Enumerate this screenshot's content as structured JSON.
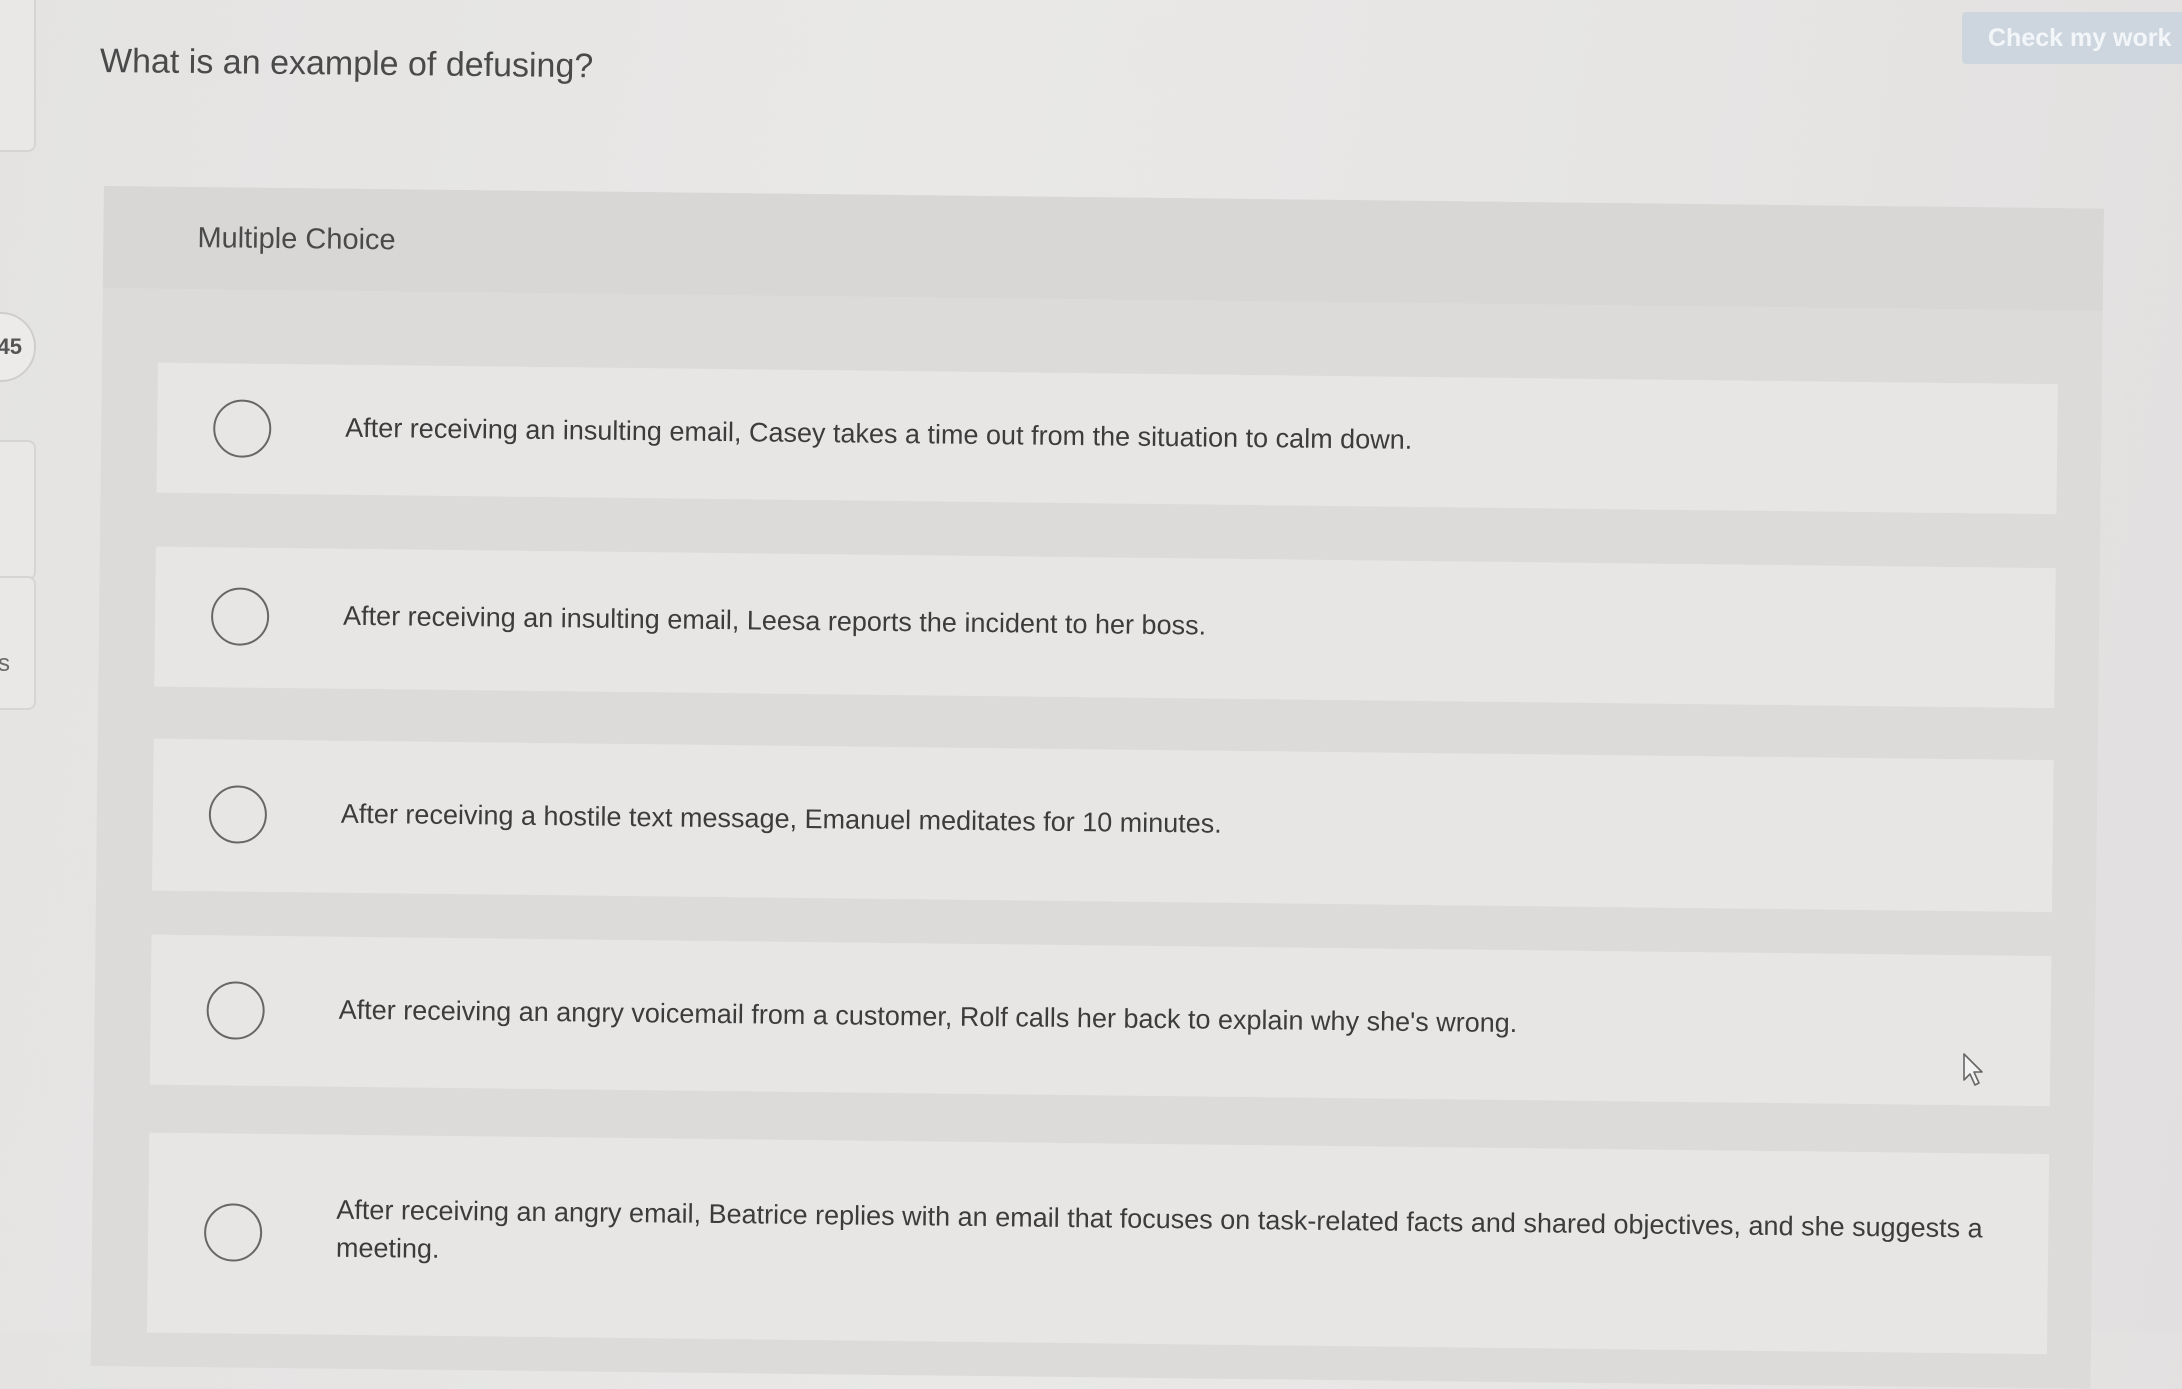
{
  "left_rail": {
    "badge_number": "45",
    "partial_label": "s"
  },
  "question": {
    "prompt": "What is an example of defusing?"
  },
  "header": {
    "check_button_label": "Check my work"
  },
  "panel": {
    "type_label": "Multiple Choice"
  },
  "options": [
    {
      "label": "After receiving an insulting email, Casey takes a time out from the situation to calm down."
    },
    {
      "label": "After receiving an insulting email, Leesa reports the incident to her boss."
    },
    {
      "label": "After receiving a hostile text message, Emanuel meditates for 10 minutes."
    },
    {
      "label": "After receiving an angry voicemail from a customer, Rolf calls her back to explain why she's wrong."
    },
    {
      "label": "After receiving an angry email, Beatrice replies with an email that focuses on task-related facts and shared objectives, and she suggests a meeting."
    }
  ],
  "icons": {
    "radio": "radio-circle-icon",
    "cursor": "mouse-pointer-icon"
  }
}
